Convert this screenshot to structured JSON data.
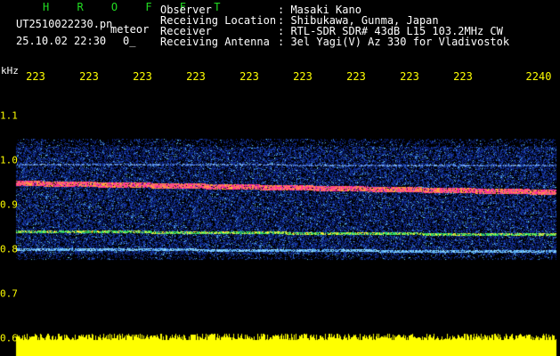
{
  "header": {
    "brand": "H R O F F T",
    "filename": "UT2510022230.pn",
    "subtitle": "meteor",
    "datetime": "25.10.02 22:30",
    "value": "0_"
  },
  "info": [
    {
      "label": "Observer",
      "value": ": Masaki Kano"
    },
    {
      "label": "Receiving Location",
      "value": ": Shibukawa, Gunma, Japan"
    },
    {
      "label": "Receiver",
      "value": ": RTL-SDR SDR# 43dB L15 103.2MHz CW"
    },
    {
      "label": "Receiving Antenna",
      "value": ": 3el Yagi(V) Az 330 for Vladivostok"
    }
  ],
  "axis": {
    "unit": "kHz",
    "x_ticks": [
      "223",
      "223",
      "223",
      "223",
      "223",
      "223",
      "223",
      "223",
      "223",
      "2240"
    ],
    "y_ticks": [
      "1.1",
      "1.0",
      "0.9",
      "0.8",
      "0.7",
      "0.6"
    ]
  },
  "colors": {
    "tick": "#ffff00",
    "brand": "#22dd22",
    "signal_band": "#ff3399",
    "noise": "#1a3aa8",
    "trace": "#ffff00"
  }
}
